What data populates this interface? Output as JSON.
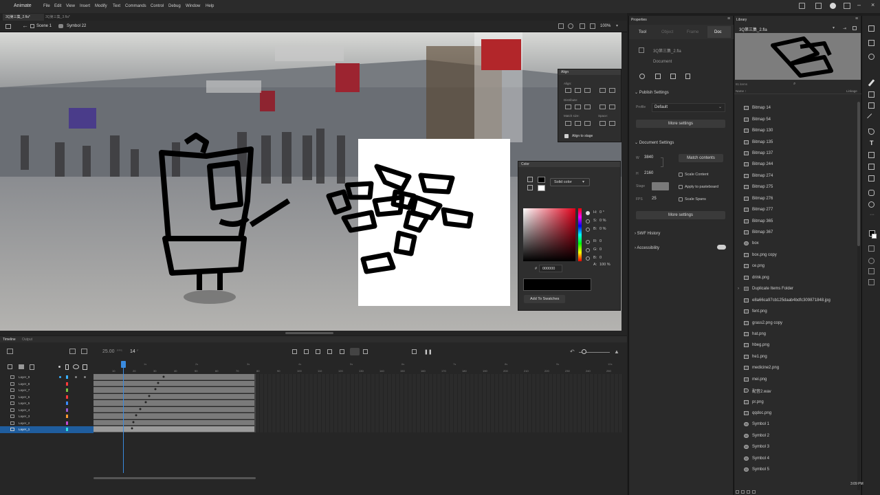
{
  "app": {
    "name": "Animate",
    "menus": [
      "File",
      "Edit",
      "View",
      "Insert",
      "Modify",
      "Text",
      "Commands",
      "Control",
      "Debug",
      "Window",
      "Help"
    ]
  },
  "tabs": [
    {
      "label": "3Q第三集_2.fla*",
      "active": true
    },
    {
      "label": "3Q第三集_3.fla*",
      "active": false
    }
  ],
  "scene": {
    "scene_label": "Scene 1",
    "symbol_label": "Symbol 22",
    "zoom": "100%"
  },
  "align_panel": {
    "title": "Align",
    "align_label": "Align:",
    "distribute_label": "Distribute:",
    "match_size_label": "Match size:",
    "space_label": "Space:",
    "align_to_stage_label": "Align to stage"
  },
  "color_panel": {
    "title": "Color",
    "fill_type": "Solid color",
    "h": "0 °",
    "s": "0 %",
    "b": "0 %",
    "r": "0",
    "g": "0",
    "bl": "0",
    "alpha": "100 %",
    "hex": "000000",
    "add_swatches": "Add To Swatches",
    "labels": {
      "h": "H:",
      "s": "S:",
      "b": "B:",
      "r": "R:",
      "g": "G:",
      "bl": "B:",
      "a": "A:",
      "hash": "#"
    }
  },
  "properties": {
    "title": "Properties",
    "tabs": [
      "Tool",
      "Object",
      "Frame",
      "Doc"
    ],
    "doc_name": "3Q第三集_2.fla",
    "doc_label": "Document",
    "publish_settings": "Publish Settings",
    "profile_label": "Profile",
    "profile_value": "Default",
    "more_settings_1": "More settings",
    "document_settings": "Document Settings",
    "w_label": "W",
    "w_value": "3840",
    "h_label": "H",
    "h_value": "2160",
    "match_contents": "Match contents",
    "stage_label": "Stage",
    "fps_label": "FPS",
    "fps_value": "25",
    "scale_content": "Scale Content",
    "apply_pasteboard": "Apply to pasteboard",
    "scale_spans": "Scale Spans",
    "more_settings_2": "More settings",
    "swf_history": "SWF History",
    "accessibility": "Accessibility"
  },
  "library": {
    "title": "Library",
    "doc": "3Q第三集_2.fla",
    "count": "81 items",
    "name_col": "Name ↑",
    "linkage_col": "Linkage",
    "items": [
      {
        "name": "Bitmap 14",
        "type": "bitmap"
      },
      {
        "name": "Bitmap 54",
        "type": "bitmap"
      },
      {
        "name": "Bitmap 130",
        "type": "bitmap"
      },
      {
        "name": "Bitmap 135",
        "type": "bitmap"
      },
      {
        "name": "Bitmap 137",
        "type": "bitmap"
      },
      {
        "name": "Bitmap 244",
        "type": "bitmap"
      },
      {
        "name": "Bitmap 274",
        "type": "bitmap"
      },
      {
        "name": "Bitmap 275",
        "type": "bitmap"
      },
      {
        "name": "Bitmap 276",
        "type": "bitmap"
      },
      {
        "name": "Bitmap 277",
        "type": "bitmap"
      },
      {
        "name": "Bitmap 365",
        "type": "bitmap"
      },
      {
        "name": "Bitmap 367",
        "type": "bitmap"
      },
      {
        "name": "box",
        "type": "symbol"
      },
      {
        "name": "box.png copy",
        "type": "bitmap"
      },
      {
        "name": "ce.png",
        "type": "bitmap"
      },
      {
        "name": "drink.png",
        "type": "bitmap"
      },
      {
        "name": "Duplicate Items Folder",
        "type": "folder"
      },
      {
        "name": "e8a66ca97cb125daab4bdfc309871848.jpg",
        "type": "bitmap"
      },
      {
        "name": "fent.png",
        "type": "bitmap"
      },
      {
        "name": "grass2.png copy",
        "type": "bitmap"
      },
      {
        "name": "hat.png",
        "type": "bitmap"
      },
      {
        "name": "hbeg.png",
        "type": "bitmap"
      },
      {
        "name": "he1.png",
        "type": "bitmap"
      },
      {
        "name": "medicine2.png",
        "type": "bitmap"
      },
      {
        "name": "mei.png",
        "type": "bitmap"
      },
      {
        "name": "配音2.wav",
        "type": "sound"
      },
      {
        "name": "pr.png",
        "type": "bitmap"
      },
      {
        "name": "qqdoc.png",
        "type": "bitmap"
      },
      {
        "name": "Symbol 1",
        "type": "symbol"
      },
      {
        "name": "Symbol 2",
        "type": "symbol"
      },
      {
        "name": "Symbol 3",
        "type": "symbol"
      },
      {
        "name": "Symbol 4",
        "type": "symbol"
      },
      {
        "name": "Symbol 5",
        "type": "symbol"
      }
    ]
  },
  "timeline": {
    "tab_timeline": "Timeline",
    "tab_output": "Output",
    "fps": "25.00",
    "fps_unit": "FPS",
    "frame": "14",
    "frame_unit": "F",
    "ruler": [
      "10",
      "20",
      "30",
      "40",
      "50",
      "60",
      "70",
      "80",
      "90",
      "100",
      "110",
      "120",
      "130",
      "140",
      "150",
      "160",
      "170",
      "180",
      "190",
      "200",
      "210",
      "220",
      "230",
      "240",
      "250"
    ],
    "seconds": [
      "1s",
      "2s",
      "3s",
      "4s",
      "5s",
      "6s",
      "7s",
      "8s",
      "9s",
      "10s"
    ],
    "layers": [
      {
        "name": "Layer_9",
        "color": "#3ab0ff"
      },
      {
        "name": "Layer_8",
        "color": "#ff3a3a"
      },
      {
        "name": "Layer_7",
        "color": "#76c442"
      },
      {
        "name": "Layer_6",
        "color": "#ff3a3a"
      },
      {
        "name": "Layer_5",
        "color": "#3a8cff"
      },
      {
        "name": "Layer_4",
        "color": "#9b59d0"
      },
      {
        "name": "Layer_3",
        "color": "#ff9a2e"
      },
      {
        "name": "Layer_2",
        "color": "#c04ad0"
      },
      {
        "name": "Layer_1",
        "color": "#2ee0e0"
      }
    ]
  },
  "clock": "3:09 PM"
}
